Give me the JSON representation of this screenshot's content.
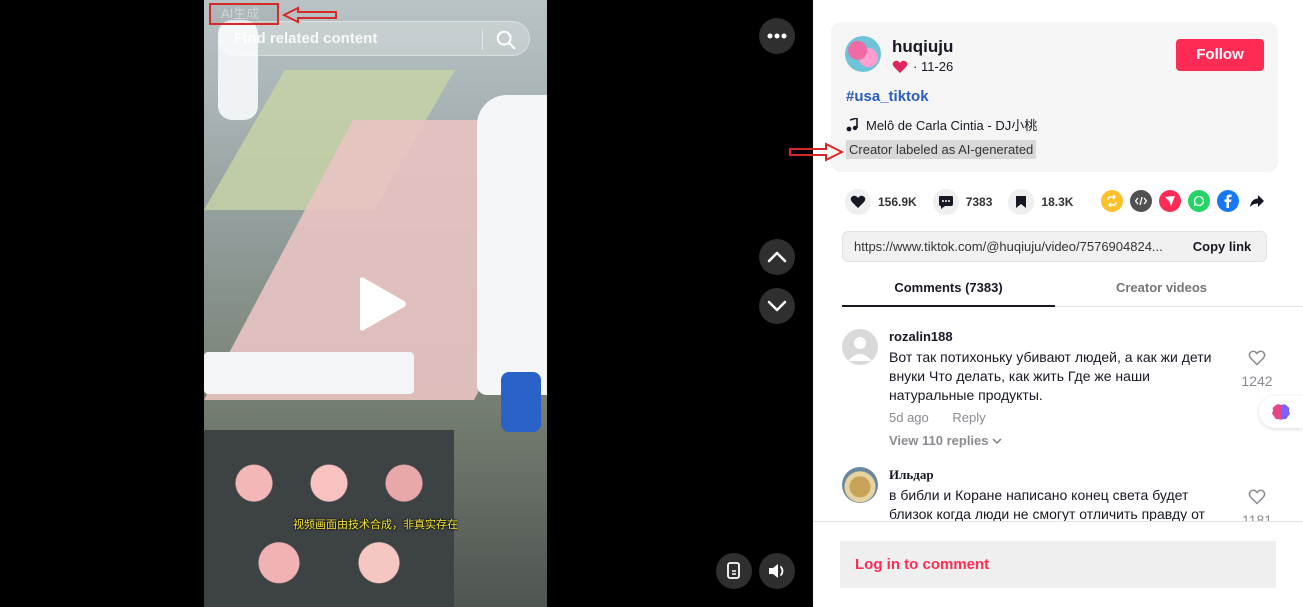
{
  "video": {
    "ai_tag": "AI生成",
    "search_placeholder": "Find related content",
    "caption": "视频画面由技术合成，非真实存在"
  },
  "creator": {
    "name": "huqiuju",
    "date": "· 11-26",
    "follow_label": "Follow",
    "hashtag": "#usa_tiktok",
    "music": "Melô de Carla Cintia - DJ小桃",
    "ai_label": "Creator labeled as AI-generated"
  },
  "stats": {
    "likes": "156.9K",
    "comments": "7383",
    "saves": "18.3K"
  },
  "share_icons": [
    "repost-icon",
    "embed-icon",
    "send-icon",
    "whatsapp-icon",
    "facebook-icon",
    "share-arrow-icon"
  ],
  "link": {
    "url": "https://www.tiktok.com/@huqiuju/video/7576904824...",
    "copy_label": "Copy link"
  },
  "tabs": {
    "comments": "Comments (7383)",
    "creator_videos": "Creator videos"
  },
  "comments": [
    {
      "user": "rozalin188",
      "text": "Вот так потихоньку убивают людей, а как жи дети внуки Что делать, как жить Где же наши натуральные продукты.",
      "time": "5d ago",
      "reply": "Reply",
      "view_replies": "View 110 replies",
      "likes": "1242"
    },
    {
      "user": "Ильдар",
      "text": "в библи и Коране написано конец света будет близок когда люди не смогут отличить правду от",
      "likes": "1181"
    }
  ],
  "login": {
    "label": "Log in to comment"
  },
  "colors": {
    "accent": "#fe2c55",
    "hashtag": "#2b5db9",
    "caption": "#f4e53a",
    "annotation": "#d62a2a"
  }
}
